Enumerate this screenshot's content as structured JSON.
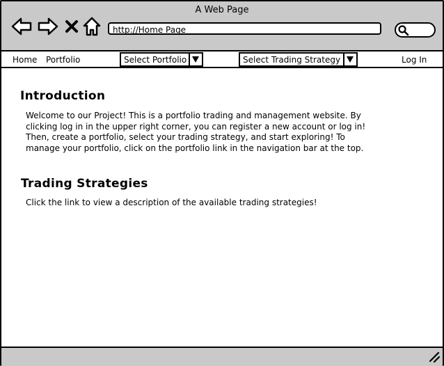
{
  "window": {
    "title": "A Web Page"
  },
  "browser": {
    "url": "http://Home Page",
    "icons": [
      "back-arrow-icon",
      "forward-arrow-icon",
      "close-x-icon",
      "home-icon",
      "search-icon"
    ]
  },
  "nav": {
    "home": "Home",
    "portfolio": "Portfolio",
    "select_portfolio": "Select Portfolio",
    "select_strategy": "Select Trading Strategy",
    "login": "Log In"
  },
  "intro": {
    "heading": "Introduction",
    "lines": [
      "Welcome to our Project! This is a portfolio trading and management website. By",
      "clicking log in in the upper right corner, you can register a new account or log in!",
      "Then, create a portfolio, select your trading strategy, and start exploring! To",
      "manage your portfolio, click on the portfolio link in the navigation bar at the top."
    ]
  },
  "strategies": {
    "heading": "Trading Strategies",
    "text": "Click the link to view a description of the available trading strategies!"
  },
  "colors": {
    "chrome": "#c9c9c9",
    "border": "#000000"
  }
}
